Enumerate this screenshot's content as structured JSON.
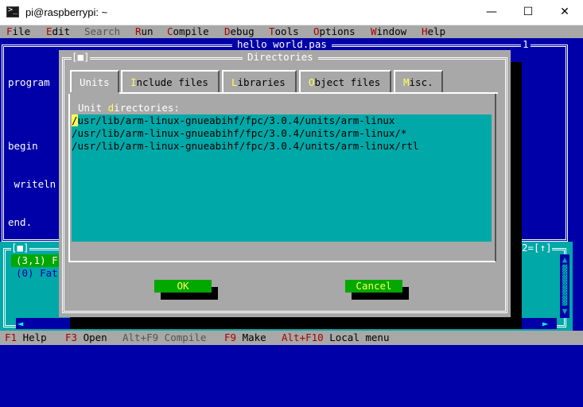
{
  "window": {
    "title": "pi@raspberrypi: ~",
    "minimize": "—",
    "maximize": "☐",
    "close": "✕"
  },
  "menu": [
    {
      "hot": "F",
      "rest": "ile"
    },
    {
      "hot": "E",
      "rest": "dit"
    },
    {
      "hot": "",
      "rest": "Search",
      "disabled": true
    },
    {
      "hot": "R",
      "rest": "un"
    },
    {
      "hot": "C",
      "rest": "ompile"
    },
    {
      "hot": "D",
      "rest": "ebug"
    },
    {
      "hot": "T",
      "rest": "ools"
    },
    {
      "hot": "O",
      "rest": "ptions"
    },
    {
      "hot": "W",
      "rest": "indow"
    },
    {
      "hot": "H",
      "rest": "elp"
    }
  ],
  "editor": {
    "title": "hello world.pas",
    "window_number": "1",
    "code_lines": [
      "program",
      "",
      "begin",
      " writeln",
      "end."
    ]
  },
  "messages": {
    "close_glyph": "[■]",
    "zoom_control": "2=[↑]",
    "selected": "(3,1) F",
    "line2": "(0) Fat"
  },
  "dialog": {
    "title": "Directories",
    "close_glyph": "[■]",
    "tabs": [
      {
        "pre": "",
        "hot": "U",
        "post": "nits",
        "active": true
      },
      {
        "pre": "",
        "hot": "I",
        "post": "nclude files"
      },
      {
        "pre": "",
        "hot": "L",
        "post": "ibraries"
      },
      {
        "pre": "",
        "hot": "O",
        "post": "bject files"
      },
      {
        "pre": "",
        "hot": "M",
        "post": "isc."
      }
    ],
    "list_label_pre": "Unit ",
    "list_label_hot": "d",
    "list_label_post": "irectories:",
    "directories": [
      "/usr/lib/arm-linux-gnueabihf/fpc/3.0.4/units/arm-linux",
      "/usr/lib/arm-linux-gnueabihf/fpc/3.0.4/units/arm-linux/*",
      "/usr/lib/arm-linux-gnueabihf/fpc/3.0.4/units/arm-linux/rtl"
    ],
    "ok_label": "OK",
    "cancel_label": "Cancel"
  },
  "status": [
    {
      "key": "F1",
      "label": " Help"
    },
    {
      "key": "F3",
      "label": " Open"
    },
    {
      "key": "",
      "label": "Alt+F9 Compile",
      "dim": true
    },
    {
      "key": "F9",
      "label": " Make"
    },
    {
      "key": "Alt+F10",
      "label": " Local menu"
    }
  ],
  "colors": {
    "desktop_blue": "#0000a8",
    "dialog_gray": "#a8a8a8",
    "cyan": "#00a8a8",
    "green_button": "#00a800",
    "hotkey_red": "#a80000",
    "hotkey_yellow": "#ffff54"
  }
}
